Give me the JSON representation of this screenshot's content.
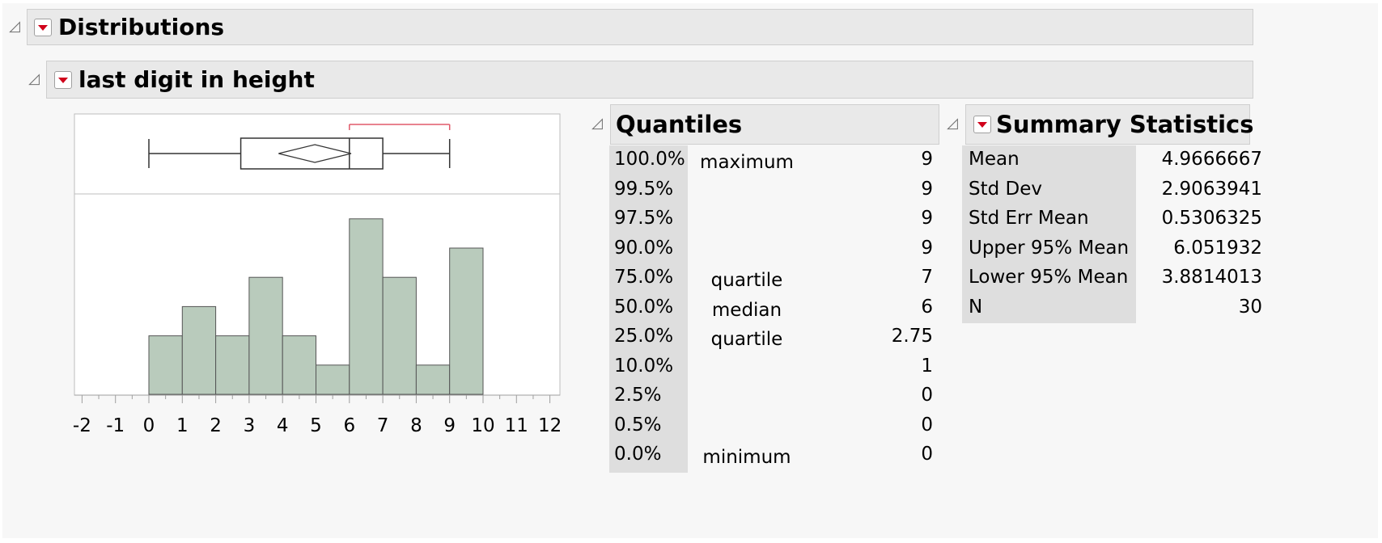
{
  "distributions": {
    "title": "Distributions"
  },
  "variable": {
    "title": "last digit in height"
  },
  "quantiles": {
    "title": "Quantiles",
    "rows": [
      {
        "pct": "100.0%",
        "label": "maximum",
        "value": "9"
      },
      {
        "pct": "99.5%",
        "label": "",
        "value": "9"
      },
      {
        "pct": "97.5%",
        "label": "",
        "value": "9"
      },
      {
        "pct": "90.0%",
        "label": "",
        "value": "9"
      },
      {
        "pct": "75.0%",
        "label": "quartile",
        "value": "7"
      },
      {
        "pct": "50.0%",
        "label": "median",
        "value": "6"
      },
      {
        "pct": "25.0%",
        "label": "quartile",
        "value": "2.75"
      },
      {
        "pct": "10.0%",
        "label": "",
        "value": "1"
      },
      {
        "pct": "2.5%",
        "label": "",
        "value": "0"
      },
      {
        "pct": "0.5%",
        "label": "",
        "value": "0"
      },
      {
        "pct": "0.0%",
        "label": "minimum",
        "value": "0"
      }
    ]
  },
  "summary": {
    "title": "Summary Statistics",
    "rows": [
      {
        "label": "Mean",
        "value": "4.9666667"
      },
      {
        "label": "Std Dev",
        "value": "2.9063941"
      },
      {
        "label": "Std Err Mean",
        "value": "0.5306325"
      },
      {
        "label": "Upper 95% Mean",
        "value": "6.051932"
      },
      {
        "label": "Lower 95% Mean",
        "value": "3.8814013"
      },
      {
        "label": "N",
        "value": "30"
      }
    ]
  },
  "chart_data": {
    "type": "bar",
    "subtype": "histogram-with-boxplot",
    "bins": [
      {
        "start": 0,
        "end": 1,
        "count": 2
      },
      {
        "start": 1,
        "end": 2,
        "count": 3
      },
      {
        "start": 2,
        "end": 3,
        "count": 2
      },
      {
        "start": 3,
        "end": 4,
        "count": 4
      },
      {
        "start": 4,
        "end": 5,
        "count": 2
      },
      {
        "start": 5,
        "end": 6,
        "count": 1
      },
      {
        "start": 6,
        "end": 7,
        "count": 6
      },
      {
        "start": 7,
        "end": 8,
        "count": 4
      },
      {
        "start": 8,
        "end": 9,
        "count": 1
      },
      {
        "start": 9,
        "end": 10,
        "count": 5
      }
    ],
    "xlim": [
      -2.2,
      12.2
    ],
    "x_ticks": [
      "-2",
      "-1",
      "0",
      "1",
      "2",
      "3",
      "4",
      "5",
      "6",
      "7",
      "8",
      "9",
      "10",
      "11",
      "12"
    ],
    "ylim": [
      0,
      6.6
    ],
    "boxplot": {
      "min": 0,
      "q1": 2.75,
      "median": 6,
      "q3": 7,
      "max": 9,
      "mean": 4.9666667,
      "mean_ci": [
        3.8814013,
        6.051932
      ],
      "shortest_half": [
        6,
        9
      ]
    },
    "colors": {
      "bar_fill": "#b9cbbc",
      "bar_stroke": "#555555",
      "shortest_half": "#e05a6a"
    }
  }
}
